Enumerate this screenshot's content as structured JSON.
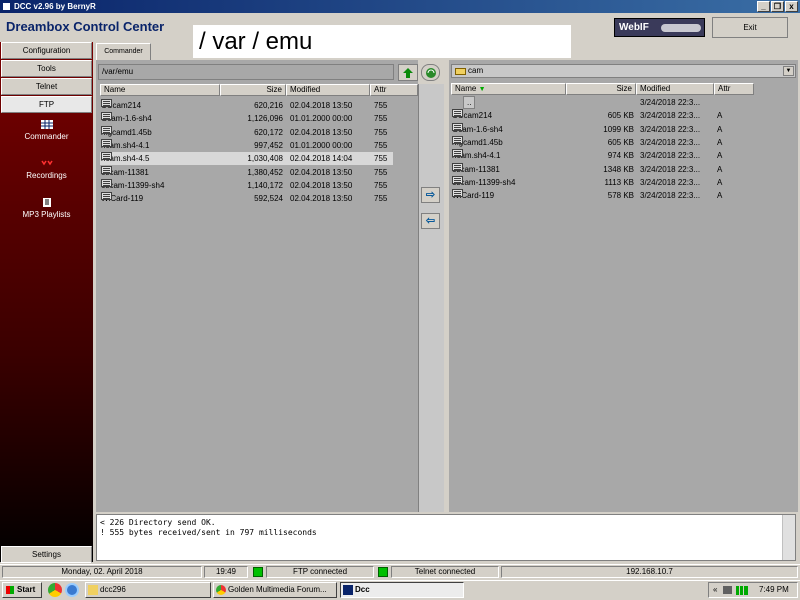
{
  "window": {
    "title": "DCC v2.96 by BernyR",
    "controls": [
      "_",
      "Ȣ",
      "x"
    ]
  },
  "header": {
    "app_title": "Dreambox Control Center",
    "path_overlay": "/ var / emu",
    "webif_label": "WebIF",
    "exit_label": "Exit"
  },
  "sidebar": {
    "tabs": [
      "Configuration",
      "Tools",
      "Telnet",
      "FTP"
    ],
    "active_tab": "FTP",
    "items": [
      {
        "label": "Commander",
        "icon": "grid-icon"
      },
      {
        "label": "Recordings",
        "icon": "film-icon"
      },
      {
        "label": "MP3 Playlists",
        "icon": "music-icon"
      }
    ],
    "settings_label": "Settings"
  },
  "commander": {
    "tab_label": "Commander",
    "left": {
      "path": "/var/emu",
      "columns": [
        "Name",
        "Size",
        "Modified",
        "Attr"
      ],
      "rows": [
        {
          "name": "CCcam214",
          "size": "620,216",
          "modified": "02.04.2018 13:50",
          "attr": "755"
        },
        {
          "name": "Gcam-1.6-sh4",
          "size": "1,126,096",
          "modified": "01.01.2000 00:00",
          "attr": "755"
        },
        {
          "name": "mgcamd1.45b",
          "size": "620,172",
          "modified": "02.04.2018 13:50",
          "attr": "755"
        },
        {
          "name": "ncam.sh4-4.1",
          "size": "997,452",
          "modified": "01.01.2000 00:00",
          "attr": "755"
        },
        {
          "name": "ncam.sh4-4.5",
          "size": "1,030,408",
          "modified": "02.04.2018 14:04",
          "attr": "755"
        },
        {
          "name": "oscam-11381",
          "size": "1,380,452",
          "modified": "02.04.2018 13:50",
          "attr": "755"
        },
        {
          "name": "oscam-11399-sh4",
          "size": "1,140,172",
          "modified": "02.04.2018 13:50",
          "attr": "755"
        },
        {
          "name": "WiCard-119",
          "size": "592,524",
          "modified": "02.04.2018 13:50",
          "attr": "755"
        }
      ],
      "selected_index": 4
    },
    "right": {
      "path": "cam",
      "columns": [
        "Name",
        "Size",
        "Modified",
        "Attr"
      ],
      "rows": [
        {
          "name": "..",
          "size": "",
          "modified": "3/24/2018 22:3...",
          "attr": ""
        },
        {
          "name": "CCcam214",
          "size": "605 KB",
          "modified": "3/24/2018 22:3...",
          "attr": "A"
        },
        {
          "name": "Gcam-1.6-sh4",
          "size": "1099 KB",
          "modified": "3/24/2018 22:3...",
          "attr": "A"
        },
        {
          "name": "mgcamd1.45b",
          "size": "605 KB",
          "modified": "3/24/2018 22:3...",
          "attr": "A"
        },
        {
          "name": "ncam.sh4-4.1",
          "size": "974 KB",
          "modified": "3/24/2018 22:3...",
          "attr": "A"
        },
        {
          "name": "oscam-11381",
          "size": "1348 KB",
          "modified": "3/24/2018 22:3...",
          "attr": "A"
        },
        {
          "name": "oscam-11399-sh4",
          "size": "1113 KB",
          "modified": "3/24/2018 22:3...",
          "attr": "A"
        },
        {
          "name": "WiCard-119",
          "size": "578 KB",
          "modified": "3/24/2018 22:3...",
          "attr": "A"
        }
      ]
    }
  },
  "log": [
    "< 226 Directory send OK.",
    "! 555 bytes received/sent in 797 milliseconds"
  ],
  "status": {
    "date": "Monday, 02. April 2018",
    "time": "19:49",
    "ftp": "FTP connected",
    "telnet": "Telnet connected",
    "ip": "192.168.10.7"
  },
  "taskbar": {
    "start": "Start",
    "tasks": [
      "dcc296",
      "Golden Multimedia Forum...",
      "Dcc"
    ],
    "active_task": "Dcc",
    "tray_chevron": "«",
    "clock": "7:49 PM"
  },
  "colors": {
    "titlebar": "#0a246a",
    "sidebar": "#7a0000",
    "panel": "#a8a8a8",
    "led_on": "#00c000"
  }
}
